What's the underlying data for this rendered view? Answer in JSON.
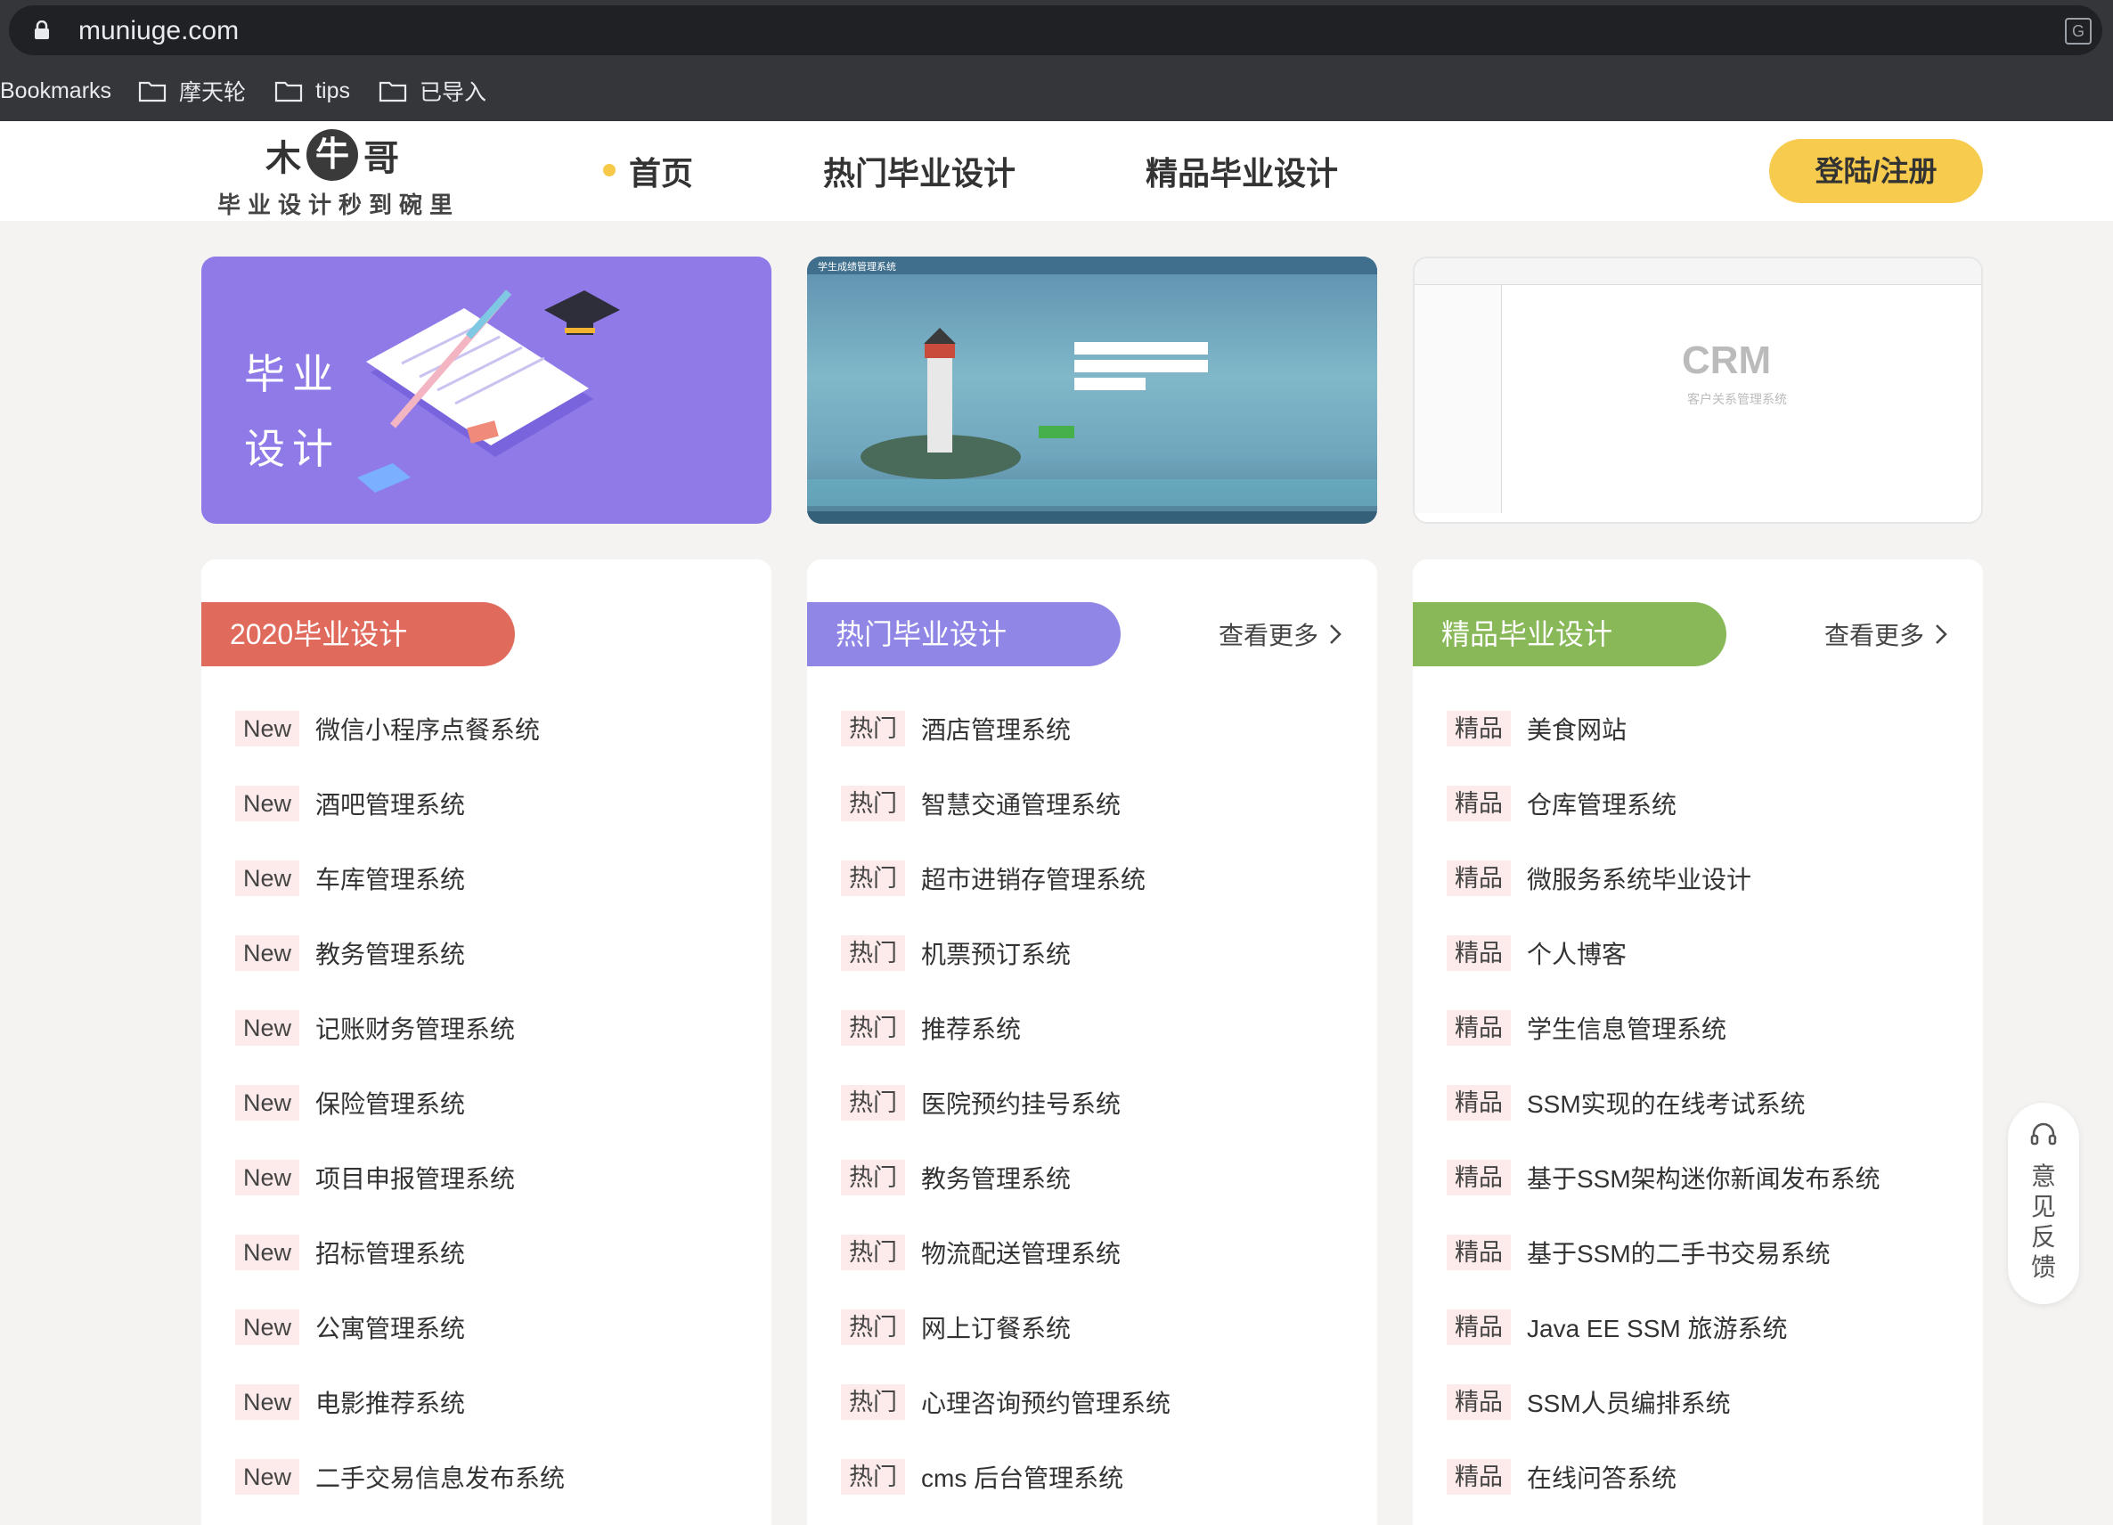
{
  "browser": {
    "url": "muniuge.com",
    "bookmarks_label": "Bookmarks",
    "bookmarks": [
      "摩天轮",
      "tips",
      "已导入"
    ]
  },
  "header": {
    "logo_chars": [
      "木",
      "牛",
      "哥"
    ],
    "logo_subtitle": "毕业设计秒到碗里",
    "nav": [
      "首页",
      "热门毕业设计",
      "精品毕业设计"
    ],
    "login_label": "登陆/注册"
  },
  "banners": {
    "b1_text": [
      "毕业",
      "设计"
    ],
    "b2_title": "学生成绩管理系统",
    "b3_logo": "CRM",
    "b3_sub": "客户关系管理系统"
  },
  "colors": {
    "accent_yellow": "#f7cb4d",
    "new_head": "#e06b5d",
    "hot_head": "#8f86e6",
    "fine_head": "#88b857"
  },
  "columns": [
    {
      "heading": "2020毕业设计",
      "more": "",
      "badge": "New",
      "items": [
        "微信小程序点餐系统",
        "酒吧管理系统",
        "车库管理系统",
        "教务管理系统",
        "记账财务管理系统",
        "保险管理系统",
        "项目申报管理系统",
        "招标管理系统",
        "公寓管理系统",
        "电影推荐系统",
        "二手交易信息发布系统"
      ]
    },
    {
      "heading": "热门毕业设计",
      "more": "查看更多",
      "badge": "热门",
      "items": [
        "酒店管理系统",
        "智慧交通管理系统",
        "超市进销存管理系统",
        "机票预订系统",
        "推荐系统",
        "医院预约挂号系统",
        "教务管理系统",
        "物流配送管理系统",
        "网上订餐系统",
        "心理咨询预约管理系统",
        "cms 后台管理系统"
      ]
    },
    {
      "heading": "精品毕业设计",
      "more": "查看更多",
      "badge": "精品",
      "items": [
        "美食网站",
        "仓库管理系统",
        "微服务系统毕业设计",
        "个人博客",
        "学生信息管理系统",
        "SSM实现的在线考试系统",
        "基于SSM架构迷你新闻发布系统",
        "基于SSM的二手书交易系统",
        "Java EE SSM 旅游系统",
        "SSM人员编排系统",
        "在线问答系统"
      ]
    }
  ],
  "feedback": "意见反馈"
}
